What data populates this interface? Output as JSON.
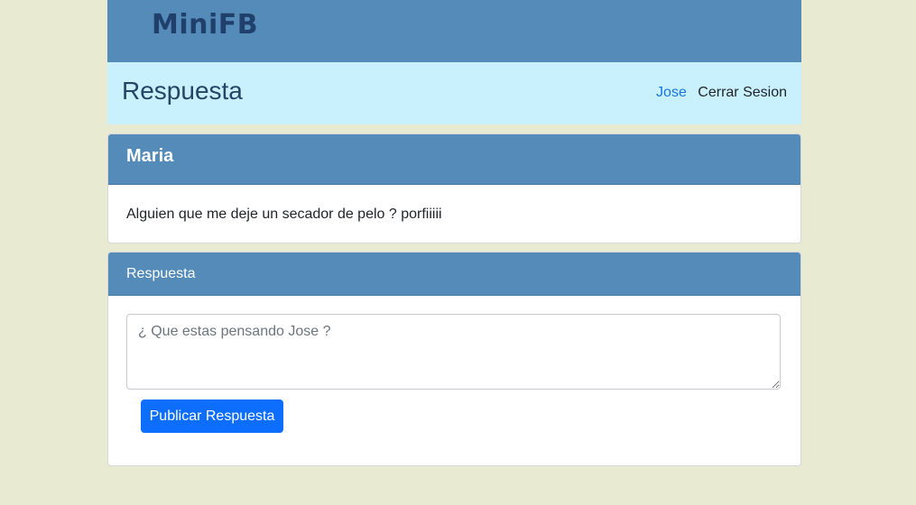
{
  "brand": {
    "name": "MiniFB"
  },
  "header": {
    "title": "Respuesta",
    "user_link": "Jose",
    "logout_link": "Cerrar Sesion"
  },
  "post": {
    "author": "Maria",
    "text": "Alguien que me deje un secador de pelo ? porfiiiii"
  },
  "reply": {
    "header": "Respuesta",
    "placeholder": "¿ Que estas pensando Jose ?",
    "value": "",
    "submit_label": "Publicar Respuesta"
  },
  "colors": {
    "page_background": "#e8ebd1",
    "brand_bar": "#548bb8",
    "title_bar": "#c8f1fd",
    "primary_button": "#0d6efd",
    "link": "#1a73e8"
  }
}
